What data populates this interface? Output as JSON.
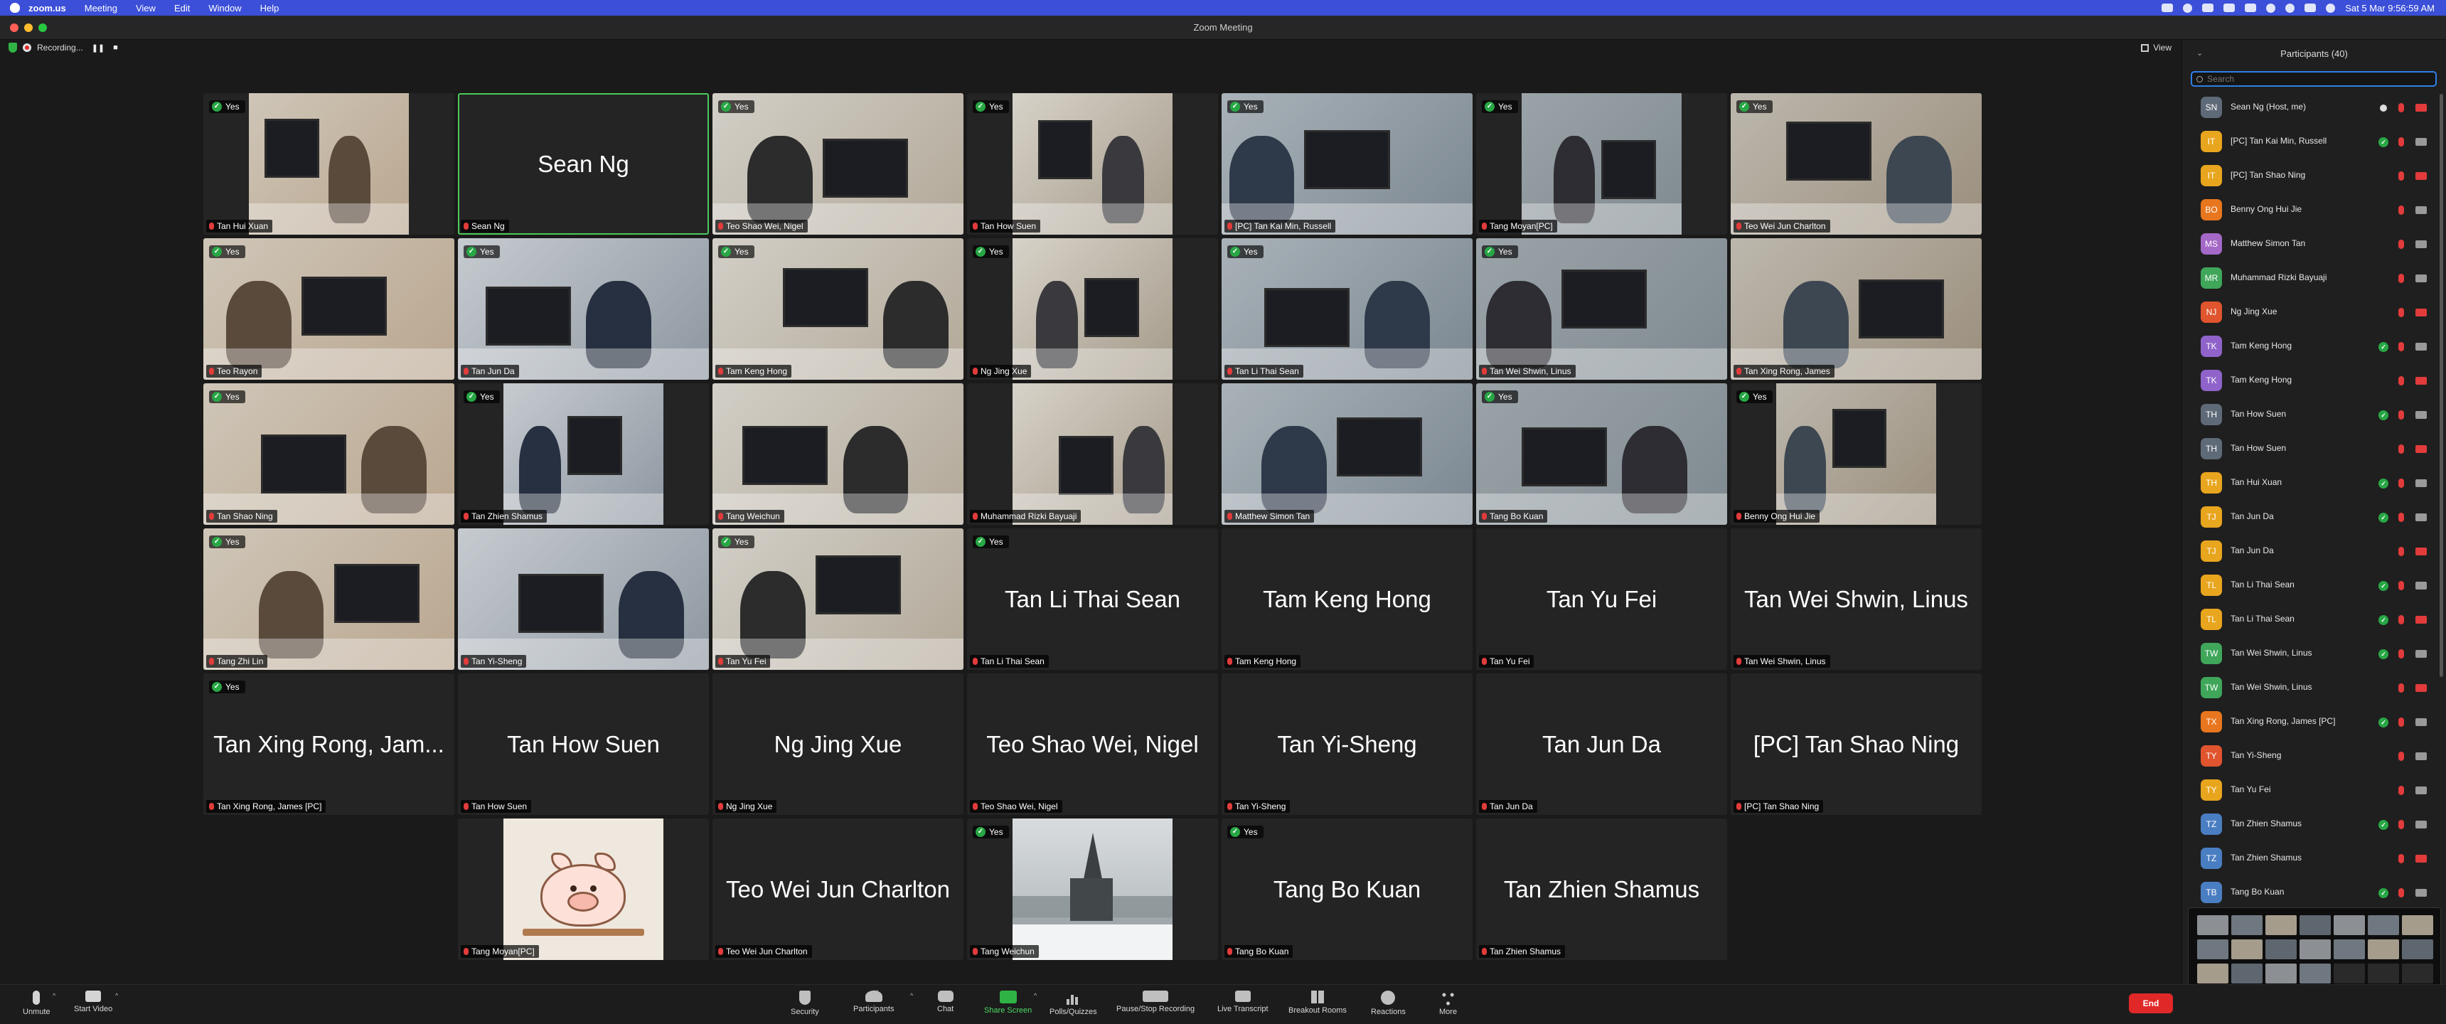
{
  "menubar": {
    "app_name": "zoom.us",
    "items": [
      "Meeting",
      "View",
      "Edit",
      "Window",
      "Help"
    ],
    "datetime": "Sat 5 Mar  9:56:59 AM"
  },
  "window": {
    "title": "Zoom Meeting"
  },
  "recording": {
    "label": "Recording...",
    "pause_glyph": "❚❚",
    "stop_glyph": "■"
  },
  "view_button": {
    "label": "View"
  },
  "tiles": [
    {
      "name": "Tan Hui Xuan",
      "yes": true,
      "video": true
    },
    {
      "name": "Sean Ng",
      "display": "Sean Ng",
      "yes": false,
      "video": false,
      "speaker": true
    },
    {
      "name": "Teo Shao Wei, Nigel",
      "yes": true,
      "video": true
    },
    {
      "name": "Tan How Suen",
      "yes": true,
      "video": true
    },
    {
      "name": "[PC] Tan Kai Min, Russell",
      "yes": true,
      "video": true
    },
    {
      "name": "Tang Moyan[PC]",
      "yes": true,
      "video": true
    },
    {
      "name": "Teo Wei Jun Charlton",
      "yes": true,
      "video": true
    },
    {
      "name": "Teo Rayon",
      "yes": true,
      "video": true
    },
    {
      "name": "Tan Jun Da",
      "yes": true,
      "video": true
    },
    {
      "name": "Tam Keng Hong",
      "yes": true,
      "video": true
    },
    {
      "name": "Ng Jing Xue",
      "yes": true,
      "video": true
    },
    {
      "name": "Tan Li Thai Sean",
      "yes": true,
      "video": true
    },
    {
      "name": "Tan Wei Shwin, Linus",
      "yes": true,
      "video": true
    },
    {
      "name": "Tan Xing Rong, James",
      "yes": false,
      "video": true
    },
    {
      "name": "Tan Shao Ning",
      "yes": true,
      "video": true
    },
    {
      "name": "Tan Zhien Shamus",
      "yes": true,
      "video": true
    },
    {
      "name": "Tang Weichun",
      "yes": false,
      "video": true
    },
    {
      "name": "Muhammad Rizki Bayuaji",
      "yes": false,
      "video": true
    },
    {
      "name": "Matthew Simon Tan",
      "yes": false,
      "video": true
    },
    {
      "name": "Tang Bo Kuan",
      "yes": true,
      "video": true
    },
    {
      "name": "Benny Ong Hui Jie",
      "yes": true,
      "video": true
    },
    {
      "name": "Tang Zhi Lin",
      "yes": true,
      "video": true
    },
    {
      "name": "Tan Yi-Sheng",
      "yes": false,
      "video": true
    },
    {
      "name": "Tan Yu Fei",
      "yes": true,
      "video": true
    },
    {
      "name": "Tan Li Thai Sean",
      "display": "Tan Li Thai Sean",
      "yes": true,
      "video": false
    },
    {
      "name": "Tam Keng Hong",
      "display": "Tam Keng Hong",
      "yes": false,
      "video": false
    },
    {
      "name": "Tan Yu Fei",
      "display": "Tan Yu Fei",
      "yes": false,
      "video": false
    },
    {
      "name": "Tan Wei Shwin, Linus",
      "display": "Tan Wei Shwin, Linus",
      "yes": false,
      "video": false
    },
    {
      "name": "Tan Xing Rong, James [PC]",
      "display": "Tan Xing Rong, Jam...",
      "yes": true,
      "video": false
    },
    {
      "name": "Tan How Suen",
      "display": "Tan How Suen",
      "yes": false,
      "video": false
    },
    {
      "name": "Ng Jing Xue",
      "display": "Ng Jing Xue",
      "yes": false,
      "video": false
    },
    {
      "name": "Teo Shao Wei, Nigel",
      "display": "Teo Shao Wei, Nigel",
      "yes": false,
      "video": false
    },
    {
      "name": "Tan Yi-Sheng",
      "display": "Tan Yi-Sheng",
      "yes": false,
      "video": false
    },
    {
      "name": "Tan Jun Da",
      "display": "Tan Jun Da",
      "yes": false,
      "video": false
    },
    {
      "name": "[PC] Tan Shao Ning",
      "display": "[PC] Tan Shao Ning",
      "yes": false,
      "video": false
    },
    {
      "name": "Tang Moyan[PC]",
      "yes": false,
      "video": "pig"
    },
    {
      "name": "Teo Wei Jun Charlton",
      "display": "Teo Wei Jun Charlton",
      "yes": false,
      "video": false
    },
    {
      "name": "Tang Weichun",
      "yes": true,
      "video": "snow"
    },
    {
      "name": "Tang Bo Kuan",
      "display": "Tang Bo Kuan",
      "yes": true,
      "video": false
    },
    {
      "name": "Tan Zhien Shamus",
      "display": "Tan Zhien Shamus",
      "yes": false,
      "video": false
    }
  ],
  "yes_label": "Yes",
  "participants_panel": {
    "title": "Participants (40)",
    "search_placeholder": "Search",
    "rows": [
      {
        "initials": "SN",
        "name": "Sean Ng (Host, me)",
        "color": "#5f6a78",
        "yes": false,
        "host": true,
        "cam_on": false
      },
      {
        "initials": "IT",
        "name": "[PC] Tan Kai Min, Russell",
        "color": "#e8a51e",
        "yes": true,
        "cam_on": true
      },
      {
        "initials": "IT",
        "name": "[PC] Tan Shao Ning",
        "color": "#e8a51e",
        "yes": false,
        "cam_on": false
      },
      {
        "initials": "BO",
        "name": "Benny Ong Hui Jie",
        "color": "#e8761e",
        "yes": false,
        "cam_on": true
      },
      {
        "initials": "MS",
        "name": "Matthew Simon Tan",
        "color": "#a468c7",
        "yes": false,
        "cam_on": true
      },
      {
        "initials": "MR",
        "name": "Muhammad Rizki Bayuaji",
        "color": "#3fa65a",
        "yes": false,
        "cam_on": true
      },
      {
        "initials": "NJ",
        "name": "Ng Jing Xue",
        "color": "#e0542e",
        "yes": false,
        "cam_on": false
      },
      {
        "initials": "TK",
        "name": "Tam Keng Hong",
        "color": "#8f63c9",
        "yes": true,
        "cam_on": true
      },
      {
        "initials": "TK",
        "name": "Tam Keng Hong",
        "color": "#8f63c9",
        "yes": false,
        "cam_on": false
      },
      {
        "initials": "TH",
        "name": "Tan How Suen",
        "color": "#5f6a78",
        "yes": true,
        "cam_on": true
      },
      {
        "initials": "TH",
        "name": "Tan How Suen",
        "color": "#5f6a78",
        "yes": false,
        "cam_on": false
      },
      {
        "initials": "TH",
        "name": "Tan Hui Xuan",
        "color": "#e8a51e",
        "yes": true,
        "cam_on": true
      },
      {
        "initials": "TJ",
        "name": "Tan Jun Da",
        "color": "#e8a51e",
        "yes": true,
        "cam_on": true
      },
      {
        "initials": "TJ",
        "name": "Tan Jun Da",
        "color": "#e8a51e",
        "yes": false,
        "cam_on": false
      },
      {
        "initials": "TL",
        "name": "Tan Li Thai Sean",
        "color": "#e8a51e",
        "yes": true,
        "cam_on": true
      },
      {
        "initials": "TL",
        "name": "Tan Li Thai Sean",
        "color": "#e8a51e",
        "yes": true,
        "cam_on": false
      },
      {
        "initials": "TW",
        "name": "Tan Wei Shwin, Linus",
        "color": "#3fa65a",
        "yes": true,
        "cam_on": true
      },
      {
        "initials": "TW",
        "name": "Tan Wei Shwin, Linus",
        "color": "#3fa65a",
        "yes": false,
        "cam_on": false
      },
      {
        "initials": "TX",
        "name": "Tan Xing Rong, James [PC]",
        "color": "#e8761e",
        "yes": true,
        "cam_on": true
      },
      {
        "initials": "TY",
        "name": "Tan Yi-Sheng",
        "color": "#e0542e",
        "yes": false,
        "cam_on": true
      },
      {
        "initials": "TY",
        "name": "Tan Yu Fei",
        "color": "#e8a51e",
        "yes": false,
        "cam_on": true
      },
      {
        "initials": "TZ",
        "name": "Tan Zhien Shamus",
        "color": "#4a7ec2",
        "yes": true,
        "cam_on": true
      },
      {
        "initials": "TZ",
        "name": "Tan Zhien Shamus",
        "color": "#4a7ec2",
        "yes": false,
        "cam_on": false
      },
      {
        "initials": "TB",
        "name": "Tang Bo Kuan",
        "color": "#4a7ec2",
        "yes": true,
        "cam_on": true
      }
    ]
  },
  "toolbar": {
    "unmute": "Unmute",
    "start_video": "Start Video",
    "security": "Security",
    "participants": "Participants",
    "participants_count": "40",
    "chat": "Chat",
    "share_screen": "Share Screen",
    "polls": "Polls/Quizzes",
    "pause_recording": "Pause/Stop Recording",
    "live_transcript": "Live Transcript",
    "breakout_rooms": "Breakout Rooms",
    "reactions": "Reactions",
    "more": "More",
    "more_glyph": "• • •",
    "end": "End"
  },
  "colors": {
    "menubar": "#3b4fd8",
    "yes_green": "#28a745",
    "mic_muted_red": "#e23b3b",
    "speaker_outline": "#4cc95a",
    "end_red": "#e02828",
    "search_focus": "#2f7fe9"
  }
}
